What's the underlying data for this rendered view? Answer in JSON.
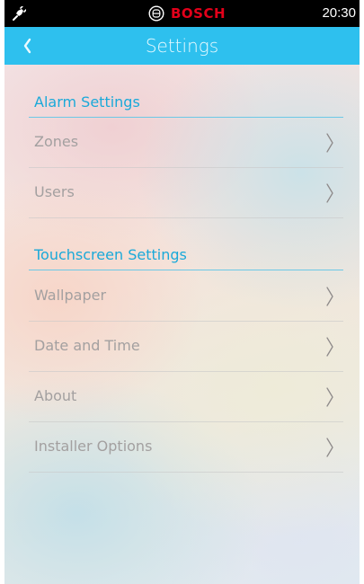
{
  "status_bar": {
    "brand": "BOSCH",
    "time": "20:30"
  },
  "header": {
    "title": "Settings"
  },
  "sections": [
    {
      "title": "Alarm Settings",
      "items": [
        {
          "label": "Zones"
        },
        {
          "label": "Users"
        }
      ]
    },
    {
      "title": "Touchscreen Settings",
      "items": [
        {
          "label": "Wallpaper"
        },
        {
          "label": "Date and Time"
        },
        {
          "label": "About"
        },
        {
          "label": "Installer Options"
        }
      ]
    }
  ],
  "colors": {
    "header_bg": "#2ec0ee",
    "section_title": "#1aa9d9",
    "brand_red": "#e2001a",
    "item_text": "#a3a0a0"
  },
  "icons": {
    "status_left": "power-plug-icon",
    "brand_logo": "bosch-logo-icon",
    "back": "chevron-left-icon",
    "row_arrow": "chevron-right-icon"
  }
}
